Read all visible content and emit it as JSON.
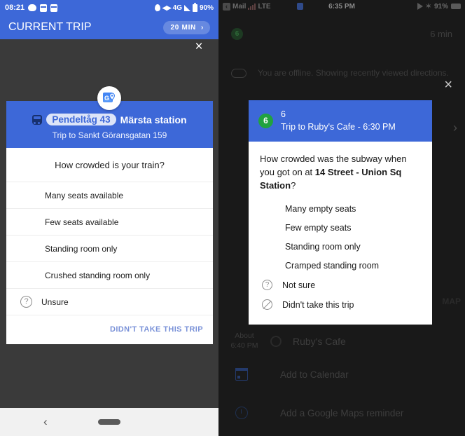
{
  "android": {
    "statusbar": {
      "time": "08:21",
      "network": "4G",
      "battery": "90%"
    },
    "header": {
      "title": "CURRENT TRIP",
      "duration_pill": "20 MIN",
      "chevron": "›"
    },
    "close_icon": "×",
    "card": {
      "badge": "Pendeltåg 43",
      "station": "Märsta station",
      "trip": "Trip to Sankt Göransgatan 159",
      "question": "How crowded is your train?",
      "options": [
        {
          "label": "Many seats available",
          "filled": 1
        },
        {
          "label": "Few seats available",
          "filled": 2
        },
        {
          "label": "Standing room only",
          "filled": 3
        },
        {
          "label": "Crushed standing room only",
          "filled": 4
        },
        {
          "label": "Unsure",
          "icon": "question-mark",
          "glyph": "?"
        }
      ],
      "footer_link": "DIDN'T TAKE THIS TRIP"
    },
    "navbar": {
      "back": "‹"
    }
  },
  "ios": {
    "statusbar": {
      "back_app": "Mail",
      "back_glyph": "‹",
      "carrier": "LTE",
      "time": "6:35 PM",
      "battery": "91%",
      "bluetooth": "✶"
    },
    "background": {
      "line_badge": "6",
      "eta": "6 min",
      "offline_message": "You are offline. Showing recently viewed directions.",
      "map_label": "MAP",
      "about_label": "About",
      "about_time": "6:40 PM",
      "destination": "Ruby's Cafe",
      "actions": [
        {
          "label": "Add to Calendar",
          "icon": "calendar-icon"
        },
        {
          "label": "Add a Google Maps reminder",
          "icon": "clock-icon"
        }
      ]
    },
    "close_icon": "×",
    "chevron_icon": "›",
    "card": {
      "line_badge": "6",
      "line_number": "6",
      "trip": "Trip to Ruby's Cafe - 6:30 PM",
      "question_prefix": "How crowded was the subway when you got on at ",
      "question_station": "14 Street - Union Sq Station",
      "question_suffix": "?",
      "options": [
        {
          "label": "Many empty seats",
          "filled": 1
        },
        {
          "label": "Few empty seats",
          "filled": 2
        },
        {
          "label": "Standing room only",
          "filled": 3
        },
        {
          "label": "Cramped standing room",
          "filled": 4
        },
        {
          "label": "Not sure",
          "icon": "question-mark",
          "glyph": "?"
        },
        {
          "label": "Didn't take this trip",
          "icon": "slash-circle",
          "glyph": ""
        }
      ]
    }
  },
  "colors": {
    "brand_blue": "#3d68d8",
    "subway_green": "#21a23f",
    "link_blue": "#7a92d8"
  }
}
